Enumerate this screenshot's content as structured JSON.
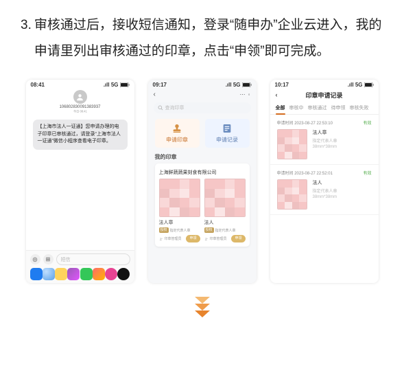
{
  "instruction": {
    "number": "3.",
    "text": "审核通过后，接收短信通知，登录“随申办”企业云进入，我的申请里列出审核通过的印章，点击“申领”即可完成。"
  },
  "phone_sms": {
    "time": "08:41",
    "signal": ".ıll 5G",
    "sender": "106802830091383937",
    "sender_label": "短信",
    "date_line": "今日 08:41",
    "bubble": "【上海市法人一证通】您申请办理的电子印章已审核通过，请登录“上海市法人一证通”微信小程序查看电子印章。",
    "input_placeholder": "短信"
  },
  "phone_app": {
    "time": "09:17",
    "signal": ".ıll 5G",
    "search_placeholder": "查询印章",
    "tab_apply": "申请印章",
    "tab_records": "申请记录",
    "section": "我的印章",
    "company": "上海鲜蔬蔬果刻食有限公司",
    "seals": [
      {
        "name": "法人章",
        "badge": "授权",
        "badge2": "指定代表人章",
        "manage": "印章管理员",
        "cta": "申领"
      },
      {
        "name": "法人",
        "badge": "授权",
        "badge2": "指定代表人章",
        "manage": "印章管理员",
        "cta": "申领"
      }
    ]
  },
  "phone_records": {
    "time": "10:17",
    "signal": ".ıll 5G",
    "title": "印章申请记录",
    "tabs": [
      "全部",
      "审核中",
      "审核通过",
      "待申领",
      "审核失败"
    ],
    "records": [
      {
        "time_label": "申请时间",
        "time": "2023-08-27 22:53:10",
        "status": "有效",
        "name": "法人章",
        "sub1": "指定代表人章",
        "sub2": "38mm*38mm"
      },
      {
        "time_label": "申请时间",
        "time": "2023-08-27 22:52:01",
        "status": "有效",
        "name": "法人",
        "sub1": "指定代表人章",
        "sub2": "38mm*38mm"
      }
    ]
  }
}
